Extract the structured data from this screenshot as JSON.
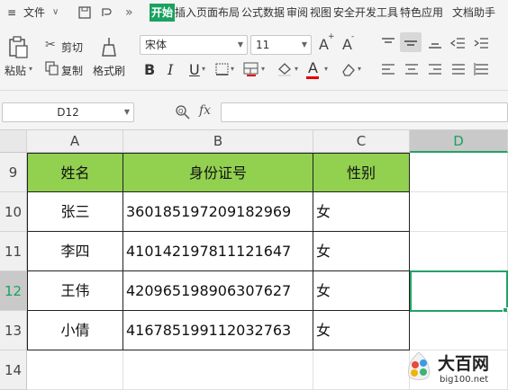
{
  "menubar": {
    "file_label": "文件",
    "more_label": "»",
    "tabs": [
      "开始",
      "插入",
      "页面布局",
      "公式",
      "数据",
      "审阅",
      "视图",
      "安全",
      "开发工具",
      "特色应用",
      "文档助手"
    ],
    "active_tab": "开始"
  },
  "ribbon": {
    "paste_label": "粘贴",
    "cut_label": "剪切",
    "copy_label": "复制",
    "format_painter_label": "格式刷",
    "font_name": "宋体",
    "font_size": "11",
    "bold": "B",
    "italic": "I",
    "underline": "U",
    "font_color_letter": "A",
    "grow_font": "A",
    "shrink_font": "A",
    "colors": {
      "accent_green": "#92d050",
      "font_color": "#e00000",
      "selection": "#21a366",
      "active_tab": "#1aa260"
    }
  },
  "formula_bar": {
    "name_box": "D12",
    "fx_label": "fx",
    "content": ""
  },
  "sheet": {
    "columns": [
      "A",
      "B",
      "C",
      "D"
    ],
    "selected_column": "D",
    "rows": [
      {
        "num": "9",
        "cells": [
          "姓名",
          "身份证号",
          "性别",
          ""
        ]
      },
      {
        "num": "10",
        "cells": [
          "张三",
          "360185197209182969",
          "女",
          ""
        ]
      },
      {
        "num": "11",
        "cells": [
          "李四",
          "410142197811121647",
          "女",
          ""
        ]
      },
      {
        "num": "12",
        "cells": [
          "王伟",
          "420965198906307627",
          "女",
          ""
        ]
      },
      {
        "num": "13",
        "cells": [
          "小倩",
          "416785199112032763",
          "女",
          ""
        ]
      },
      {
        "num": "14",
        "cells": [
          "",
          "",
          "",
          ""
        ]
      }
    ],
    "selected_row": "12",
    "selected_cell": "D12"
  },
  "watermark": {
    "brand": "大百网",
    "url": "big100.net"
  }
}
